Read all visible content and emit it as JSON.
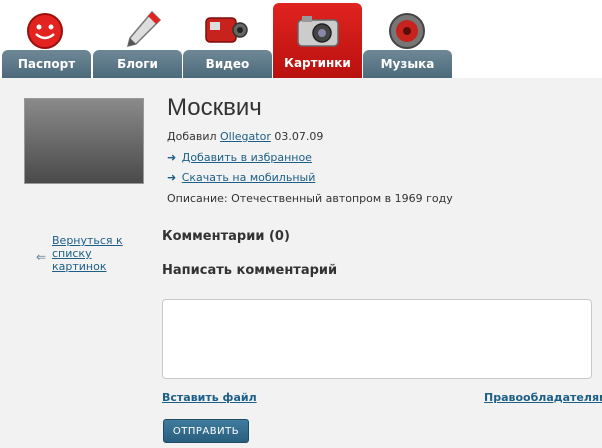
{
  "tabs": [
    {
      "label": "Паспорт",
      "icon": "smiley-icon"
    },
    {
      "label": "Блоги",
      "icon": "pencil-icon"
    },
    {
      "label": "Видео",
      "icon": "video-camera-icon"
    },
    {
      "label": "Картинки",
      "icon": "photo-camera-icon",
      "active": true
    },
    {
      "label": "Музыка",
      "icon": "speaker-icon"
    }
  ],
  "picture": {
    "title": "Москвич",
    "added_prefix": "Добавил",
    "author": "Ollegator",
    "date": "03.07.09",
    "favorite_link": "Добавить в избранное",
    "mobile_link": "Скачать на мобильный",
    "description": "Описание: Отечественный автопром в 1969 году"
  },
  "back_link": "Вернуться к списку картинок",
  "comments_heading": "Комментарии (0)",
  "write_heading": "Написать комментарий",
  "insert_file": "Вставить файл",
  "copyright": "Правообладателям",
  "submit": "ОТПРАВИТЬ"
}
